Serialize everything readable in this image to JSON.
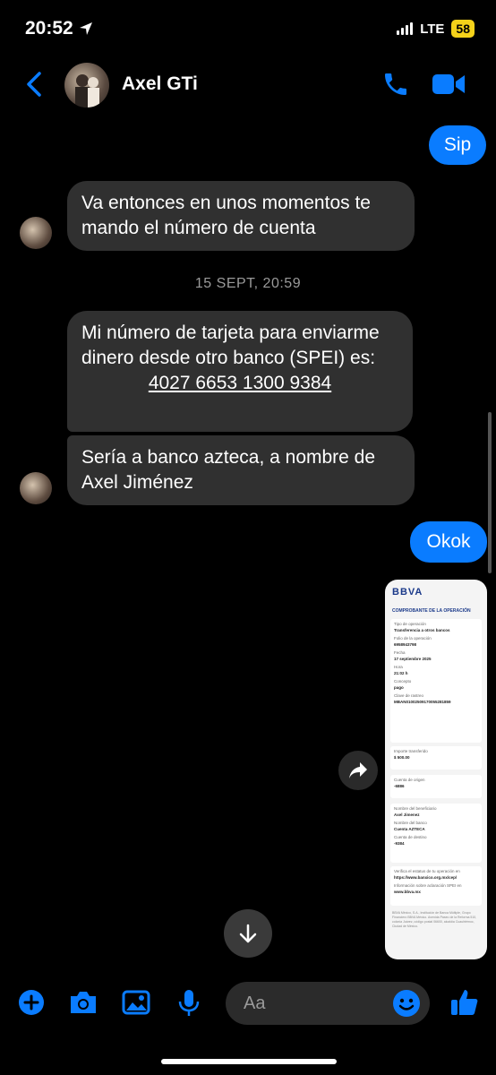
{
  "status": {
    "time": "20:52",
    "network": "LTE",
    "battery": "58"
  },
  "header": {
    "name": "Axel GTi"
  },
  "messages": {
    "m1": "Sip",
    "m2": "Va entonces en unos momentos te mando el número de cuenta",
    "timestamp": "15 SEPT, 20:59",
    "m3_text": "Mi número de tarjeta para enviarme dinero desde otro banco (SPEI) es:",
    "m3_card": "4027 6653 1300 9384",
    "m4": "Sería a banco azteca, a nombre de Axel Jiménez",
    "m5": "Okok"
  },
  "receipt": {
    "logo": "BBVA",
    "title": "COMPROBANTE DE LA OPERACIÓN",
    "tipo_label": "Tipo de operación",
    "tipo_value": "Transferencia a otros bancos",
    "folio_label": "Folio de la operación",
    "folio_value": "6958943798",
    "fecha_label": "Fecha",
    "fecha_value": "17 septiembre 2025",
    "hora_label": "Hora",
    "hora_value": "21:02 h",
    "concepto_label": "Concepto",
    "concepto_value": "pago",
    "clave_label": "Clave de rastreo",
    "clave_value": "MBAN01002509170055281859",
    "importe_label": "Importe transferido",
    "importe_value": "$ 500.00",
    "origen_label": "Cuenta de origen",
    "origen_value": "-6886",
    "benef_label": "Nombre del beneficiario",
    "benef_value": "Axel Jimenez",
    "banco_label": "Nombre del banco",
    "banco_value": "Cuenta AZTECA",
    "destino_label": "Cuenta de destino",
    "destino_value": "-9384",
    "verifica_label": "Verifica el estatus de tu operación en",
    "verifica_value": "https://www.banxico.org.mx/cep/",
    "info_label": "Información sobre aclaración SPEI en",
    "info_value": "www.bbva.mx",
    "footer": "BBVA México, S.A., Institución de Banca Múltiple, Grupo Financiero BBVA México. Avenida Paseo de la Reforma 510, colonia Juárez, código postal 06600, alcaldía Cuauhtémoc, Ciudad de México."
  },
  "composer": {
    "placeholder": "Aa"
  },
  "colors": {
    "accent": "#0a7cff",
    "incoming": "#303030",
    "battery": "#f5d21a"
  }
}
